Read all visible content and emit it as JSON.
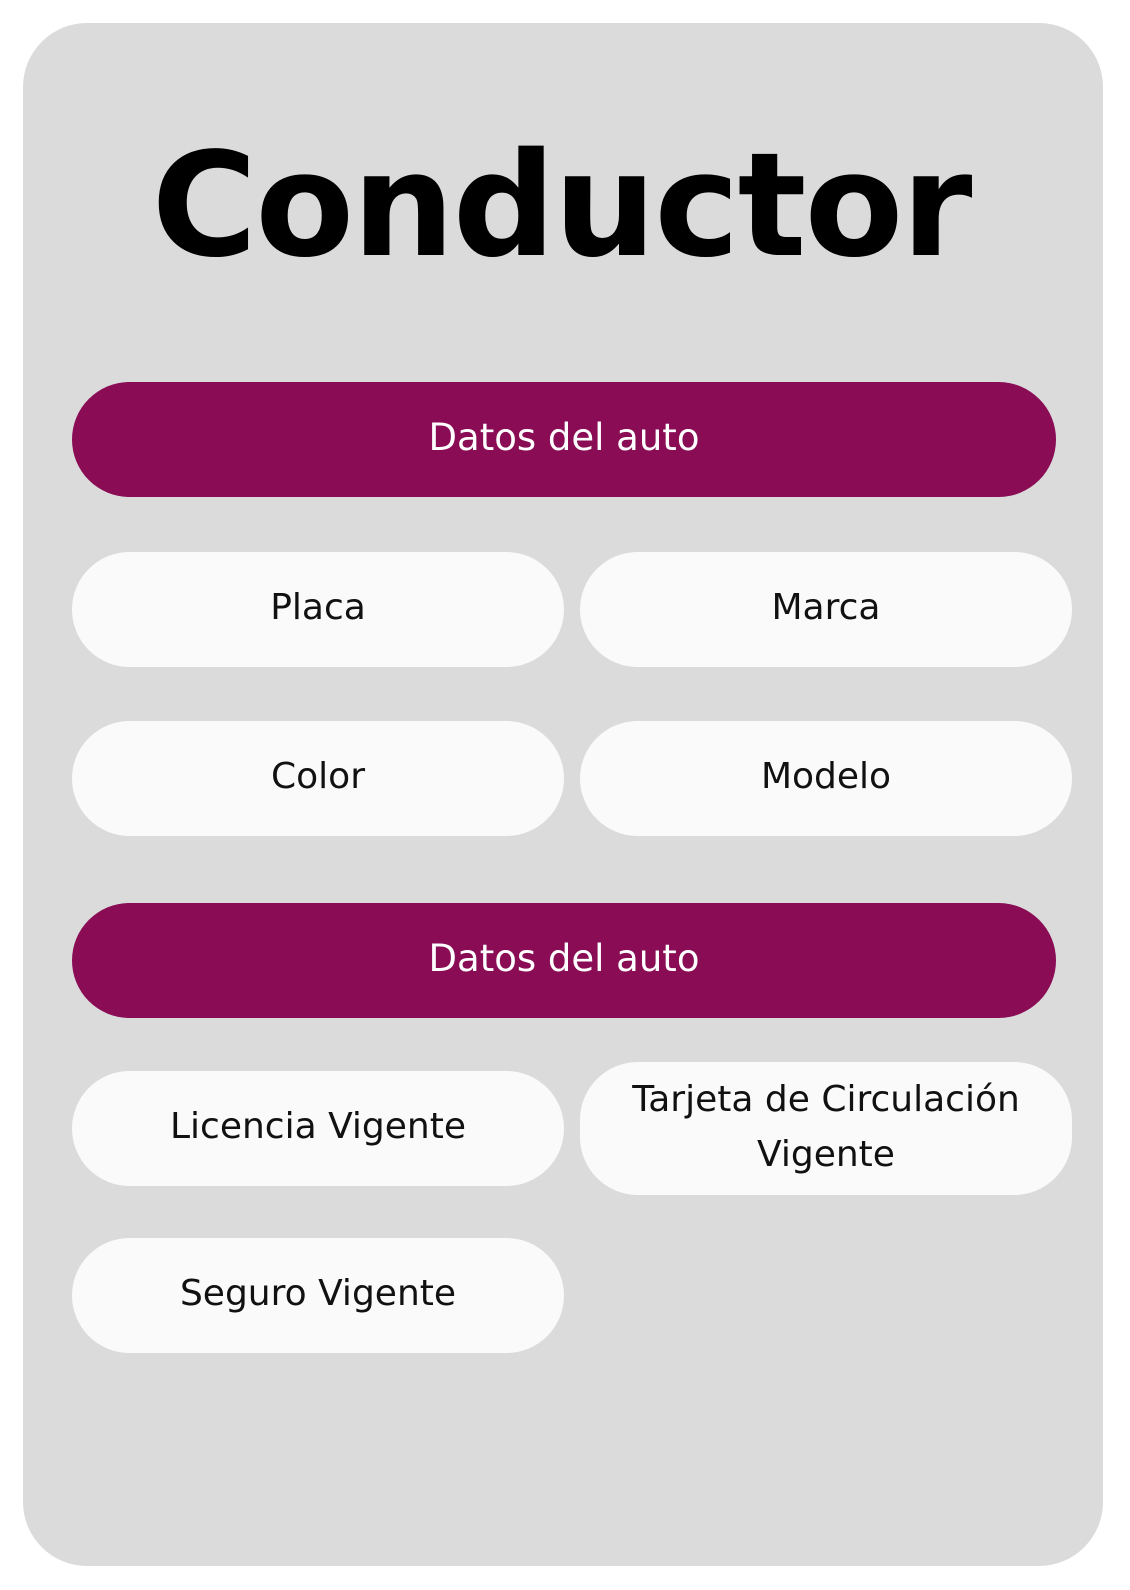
{
  "page": {
    "title": "Conductor"
  },
  "sections": [
    {
      "header": "Datos del auto",
      "fields": [
        "Placa",
        "Marca",
        "Color",
        "Modelo"
      ]
    },
    {
      "header": "Datos del auto",
      "fields": [
        "Licencia Vigente",
        "Tarjeta de Circulación Vigente",
        "Seguro Vigente"
      ]
    }
  ],
  "colors": {
    "card_background": "#dbdbdb",
    "header_accent": "#890c55",
    "field_background": "#fafafa"
  }
}
